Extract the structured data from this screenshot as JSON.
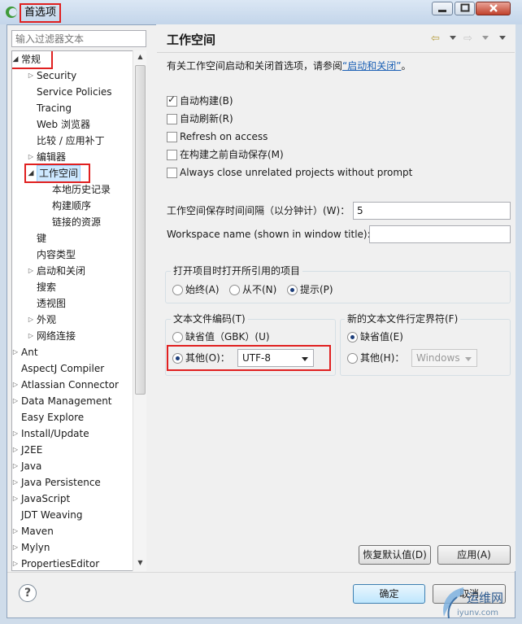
{
  "window": {
    "title": "首选项",
    "minimize_icon": "minimize-icon",
    "maximize_icon": "maximize-icon",
    "close_icon": "close-icon"
  },
  "filter": {
    "placeholder": "输入过滤器文本"
  },
  "tree": {
    "items": [
      {
        "label": "常规",
        "expanded": true,
        "highlight": true
      },
      {
        "label": "Security"
      },
      {
        "label": "Service Policies"
      },
      {
        "label": "Tracing"
      },
      {
        "label": "Web 浏览器"
      },
      {
        "label": "比较 / 应用补丁"
      },
      {
        "label": "编辑器"
      },
      {
        "label": "工作空间",
        "expanded": true,
        "selected": true,
        "highlight": true
      },
      {
        "label": "本地历史记录"
      },
      {
        "label": "构建顺序"
      },
      {
        "label": "链接的资源"
      },
      {
        "label": "键"
      },
      {
        "label": "内容类型"
      },
      {
        "label": "启动和关闭"
      },
      {
        "label": "搜索"
      },
      {
        "label": "透视图"
      },
      {
        "label": "外观"
      },
      {
        "label": "网络连接"
      },
      {
        "label": "Ant"
      },
      {
        "label": "AspectJ Compiler"
      },
      {
        "label": "Atlassian Connector"
      },
      {
        "label": "Data Management"
      },
      {
        "label": "Easy Explore"
      },
      {
        "label": "Install/Update"
      },
      {
        "label": "J2EE"
      },
      {
        "label": "Java"
      },
      {
        "label": "Java Persistence"
      },
      {
        "label": "JavaScript"
      },
      {
        "label": "JDT Weaving"
      },
      {
        "label": "Maven"
      },
      {
        "label": "Mylyn"
      },
      {
        "label": "PropertiesEditor"
      }
    ]
  },
  "page": {
    "title": "工作空间",
    "description_prefix": "有关工作空间启动和关闭首选项，请参阅",
    "description_link": "“启动和关闭”",
    "description_suffix": "。",
    "checkboxes": [
      {
        "label": "自动构建(B)",
        "checked": true
      },
      {
        "label": "自动刷新(R)",
        "checked": false
      },
      {
        "label": "Refresh on access",
        "checked": false
      },
      {
        "label": "在构建之前自动保存(M)",
        "checked": false
      },
      {
        "label": "Always close unrelated projects without prompt",
        "checked": false
      }
    ],
    "save_interval": {
      "label": "工作空间保存时间间隔（以分钟计）(W)：",
      "value": "5"
    },
    "workspace_name": {
      "label": "Workspace name (shown in window title):",
      "value": ""
    },
    "open_refs": {
      "title": "打开项目时打开所引用的项目",
      "options": [
        "始终(A)",
        "从不(N)",
        "提示(P)"
      ],
      "selected": "提示(P)"
    },
    "encoding": {
      "title": "文本文件编码(T)",
      "default_option": "缺省值（GBK）(U)",
      "other_option": "其他(O)：",
      "selected": "其他(O)：",
      "other_value": "UTF-8"
    },
    "line_delimiter": {
      "title": "新的文本文件行定界符(F)",
      "default_option": "缺省值(E)",
      "other_option": "其他(H)：",
      "selected": "缺省值(E)",
      "other_value": "Windows"
    },
    "restore_defaults": "恢复默认值(D)",
    "apply": "应用(A)"
  },
  "footer": {
    "ok": "确定",
    "cancel": "取消"
  },
  "watermark": {
    "brand": "运维网",
    "site": "iyunv.com"
  },
  "colors": {
    "highlight_box": "#e02020",
    "link": "#1a5fb4",
    "selection": "#cde8ff"
  }
}
